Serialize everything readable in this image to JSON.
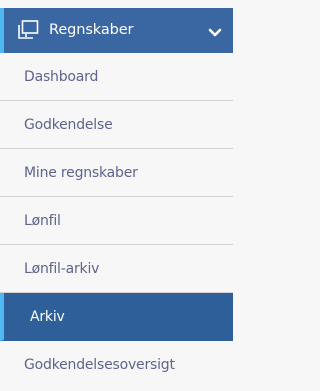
{
  "sidebar": {
    "section": {
      "title": "Regnskaber",
      "icon": "copy-documents-icon",
      "toggle_icon": "chevron-down-icon",
      "expanded": true
    },
    "items": [
      {
        "label": "Dashboard",
        "active": false
      },
      {
        "label": "Godkendelse",
        "active": false
      },
      {
        "label": "Mine regnskaber",
        "active": false
      },
      {
        "label": "Lønfil",
        "active": false
      },
      {
        "label": "Lønfil-arkiv",
        "active": false
      },
      {
        "label": "Arkiv",
        "active": true
      },
      {
        "label": "Godkendelsesoversigt",
        "active": false
      }
    ],
    "colors": {
      "header_bg": "#3a66a1",
      "active_bg": "#2e5f98",
      "accent": "#4fb8f0",
      "item_text": "#5f6390",
      "background": "#f7f7f7"
    }
  }
}
